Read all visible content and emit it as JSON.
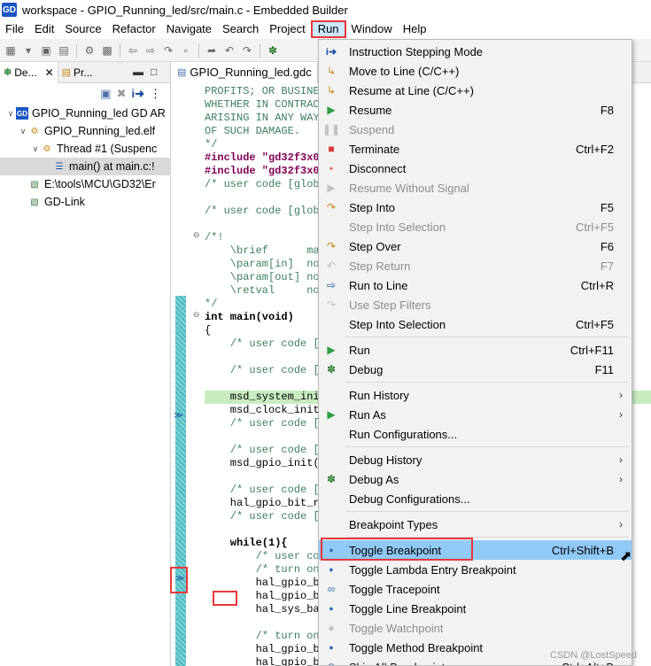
{
  "window": {
    "logo": "GD",
    "title": "workspace - GPIO_Running_led/src/main.c - Embedded Builder"
  },
  "menubar": [
    "File",
    "Edit",
    "Source",
    "Refactor",
    "Navigate",
    "Search",
    "Project",
    "Run",
    "Window",
    "Help"
  ],
  "left_pane": {
    "tabs": [
      {
        "label": "De...",
        "icon": "debug-icon"
      },
      {
        "label": "Pr...",
        "icon": "project-explorer-icon"
      }
    ],
    "tree": [
      {
        "label": "GPIO_Running_led GD AR",
        "indent": 0,
        "twisty": "v",
        "icon": "launch-config-icon"
      },
      {
        "label": "GPIO_Running_led.elf",
        "indent": 1,
        "twisty": "v",
        "icon": "elf-process-icon"
      },
      {
        "label": "Thread #1 (Suspenc",
        "indent": 2,
        "twisty": "v",
        "icon": "thread-icon"
      },
      {
        "label": "main() at main.c:!",
        "indent": 3,
        "twisty": "",
        "icon": "stack-frame-icon",
        "selected": true
      },
      {
        "label": "E:\\tools\\MCU\\GD32\\Er",
        "indent": 1,
        "twisty": "",
        "icon": "gdb-icon"
      },
      {
        "label": "GD-Link",
        "indent": 1,
        "twisty": "",
        "icon": "gdb-icon"
      }
    ]
  },
  "editor": {
    "tab_label": "GPIO_Running_led.gdc",
    "lines": [
      {
        "t": "PROFITS; OR BUSINES",
        "k": "comment"
      },
      {
        "t": "WHETHER IN CONTRACT",
        "k": "comment"
      },
      {
        "t": "ARISING IN ANY WAY",
        "k": "comment"
      },
      {
        "t": "OF SUCH DAMAGE.",
        "k": "comment"
      },
      {
        "t": "*/",
        "k": "comment"
      },
      {
        "t": "#include \"gd32f3x0_",
        "k": "include"
      },
      {
        "t": "#include \"gd32f3x0_",
        "k": "include"
      },
      {
        "t": "/* user code [globa",
        "k": "comment"
      },
      {
        "t": "",
        "k": "plain"
      },
      {
        "t": "/* user code [globa",
        "k": "comment"
      },
      {
        "t": "",
        "k": "plain"
      },
      {
        "t": "/*!",
        "k": "comment"
      },
      {
        "t": "    \\brief      mai",
        "k": "comment"
      },
      {
        "t": "    \\param[in]  non",
        "k": "comment"
      },
      {
        "t": "    \\param[out] non",
        "k": "comment"
      },
      {
        "t": "    \\retval     non",
        "k": "comment"
      },
      {
        "t": "*/",
        "k": "comment"
      },
      {
        "t": "int main(void)",
        "k": "bold"
      },
      {
        "t": "{",
        "k": "plain"
      },
      {
        "t": "    /* user code [:",
        "k": "comment"
      },
      {
        "t": "",
        "k": "plain"
      },
      {
        "t": "    /* user code [:",
        "k": "comment"
      },
      {
        "t": "",
        "k": "plain"
      },
      {
        "t": "    msd_system_init",
        "k": "highlight"
      },
      {
        "t": "    msd_clock_init",
        "k": "plain"
      },
      {
        "t": "    /* user code [:",
        "k": "comment"
      },
      {
        "t": "",
        "k": "plain"
      },
      {
        "t": "    /* user code [:",
        "k": "comment"
      },
      {
        "t": "    msd_gpio_init(",
        "k": "plain"
      },
      {
        "t": "",
        "k": "plain"
      },
      {
        "t": "    /* user code [:",
        "k": "comment"
      },
      {
        "t": "    hal_gpio_bit_re",
        "k": "plain"
      },
      {
        "t": "    /* user code [:",
        "k": "comment"
      },
      {
        "t": "",
        "k": "plain"
      },
      {
        "t": "    while(1){",
        "k": "bold"
      },
      {
        "t": "        /* user co",
        "k": "comment"
      },
      {
        "t": "        /* turn on",
        "k": "comment"
      },
      {
        "t": "        hal_gpio_bi",
        "k": "plain"
      },
      {
        "t": "        hal_gpio_bi",
        "k": "plain"
      },
      {
        "t": "        hal_sys_bas",
        "k": "plain"
      },
      {
        "t": "",
        "k": "plain"
      },
      {
        "t": "        /* turn on",
        "k": "comment"
      },
      {
        "t": "        hal_gpio_bi",
        "k": "plain"
      },
      {
        "t": "        hal_gpio_bi",
        "k": "plain"
      }
    ]
  },
  "run_menu": {
    "items": [
      {
        "label": "Instruction Stepping Mode",
        "shortcut": "",
        "icon": "instruction-stepping-icon",
        "disabled": false,
        "submenu": false
      },
      {
        "label": "Move to Line (C/C++)",
        "shortcut": "",
        "icon": "move-to-line-icon",
        "disabled": false,
        "submenu": false
      },
      {
        "label": "Resume at Line (C/C++)",
        "shortcut": "",
        "icon": "resume-at-line-icon",
        "disabled": false,
        "submenu": false
      },
      {
        "label": "Resume",
        "shortcut": "F8",
        "icon": "resume-icon",
        "disabled": false,
        "submenu": false
      },
      {
        "label": "Suspend",
        "shortcut": "",
        "icon": "suspend-icon",
        "disabled": true,
        "submenu": false
      },
      {
        "label": "Terminate",
        "shortcut": "Ctrl+F2",
        "icon": "terminate-icon",
        "disabled": false,
        "submenu": false
      },
      {
        "label": "Disconnect",
        "shortcut": "",
        "icon": "disconnect-icon",
        "disabled": false,
        "submenu": false
      },
      {
        "label": "Resume Without Signal",
        "shortcut": "",
        "icon": "resume-without-signal-icon",
        "disabled": true,
        "submenu": false
      },
      {
        "label": "Step Into",
        "shortcut": "F5",
        "icon": "step-into-icon",
        "disabled": false,
        "submenu": false
      },
      {
        "label": "Step Into Selection",
        "shortcut": "Ctrl+F5",
        "icon": "",
        "disabled": true,
        "submenu": false
      },
      {
        "label": "Step Over",
        "shortcut": "F6",
        "icon": "step-over-icon",
        "disabled": false,
        "submenu": false
      },
      {
        "label": "Step Return",
        "shortcut": "F7",
        "icon": "step-return-icon",
        "disabled": true,
        "submenu": false
      },
      {
        "label": "Run to Line",
        "shortcut": "Ctrl+R",
        "icon": "run-to-line-icon",
        "disabled": false,
        "submenu": false
      },
      {
        "label": "Use Step Filters",
        "shortcut": "",
        "icon": "step-filters-icon",
        "disabled": true,
        "submenu": false
      },
      {
        "label": "Step Into Selection",
        "shortcut": "Ctrl+F5",
        "icon": "",
        "disabled": false,
        "submenu": false
      },
      {
        "sep": true
      },
      {
        "label": "Run",
        "shortcut": "Ctrl+F11",
        "icon": "run-icon",
        "disabled": false,
        "submenu": false
      },
      {
        "label": "Debug",
        "shortcut": "F11",
        "icon": "debug-bug-icon",
        "disabled": false,
        "submenu": false
      },
      {
        "sep": true
      },
      {
        "label": "Run History",
        "shortcut": "",
        "icon": "",
        "disabled": false,
        "submenu": true
      },
      {
        "label": "Run As",
        "shortcut": "",
        "icon": "run-as-icon",
        "disabled": false,
        "submenu": true
      },
      {
        "label": "Run Configurations...",
        "shortcut": "",
        "icon": "",
        "disabled": false,
        "submenu": false
      },
      {
        "sep": true
      },
      {
        "label": "Debug History",
        "shortcut": "",
        "icon": "",
        "disabled": false,
        "submenu": true
      },
      {
        "label": "Debug As",
        "shortcut": "",
        "icon": "debug-as-icon",
        "disabled": false,
        "submenu": true
      },
      {
        "label": "Debug Configurations...",
        "shortcut": "",
        "icon": "",
        "disabled": false,
        "submenu": false
      },
      {
        "sep": true
      },
      {
        "label": "Breakpoint Types",
        "shortcut": "",
        "icon": "",
        "disabled": false,
        "submenu": true
      },
      {
        "sep": true
      },
      {
        "label": "Toggle Breakpoint",
        "shortcut": "Ctrl+Shift+B",
        "icon": "breakpoint-dot-icon",
        "disabled": false,
        "submenu": false,
        "highlighted": true
      },
      {
        "label": "Toggle Lambda Entry Breakpoint",
        "shortcut": "",
        "icon": "breakpoint-dot-icon",
        "disabled": false,
        "submenu": false
      },
      {
        "label": "Toggle Tracepoint",
        "shortcut": "",
        "icon": "tracepoint-icon",
        "disabled": false,
        "submenu": false
      },
      {
        "label": "Toggle Line Breakpoint",
        "shortcut": "",
        "icon": "breakpoint-dot-icon",
        "disabled": false,
        "submenu": false
      },
      {
        "label": "Toggle Watchpoint",
        "shortcut": "",
        "icon": "watchpoint-icon",
        "disabled": true,
        "submenu": false
      },
      {
        "label": "Toggle Method Breakpoint",
        "shortcut": "",
        "icon": "breakpoint-dot-icon",
        "disabled": false,
        "submenu": false
      },
      {
        "label": "Skip All Breakpoints",
        "shortcut": "Ctrl+Alt+B",
        "icon": "skip-breakpoints-icon",
        "disabled": false,
        "submenu": false
      }
    ]
  },
  "watermark": "CSDN @LostSpeed",
  "colors": {
    "highlight_box": "#e8373b",
    "menu_hover": "#91c9f7",
    "code_comment": "#3f7f5f",
    "code_keyword": "#7f0055"
  }
}
